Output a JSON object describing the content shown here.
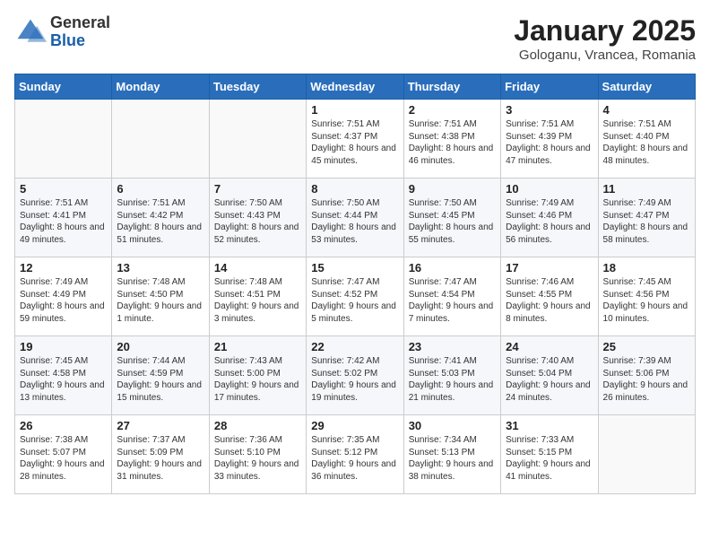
{
  "logo": {
    "general": "General",
    "blue": "Blue"
  },
  "title": "January 2025",
  "location": "Gologanu, Vrancea, Romania",
  "weekdays": [
    "Sunday",
    "Monday",
    "Tuesday",
    "Wednesday",
    "Thursday",
    "Friday",
    "Saturday"
  ],
  "weeks": [
    [
      {
        "day": "",
        "info": ""
      },
      {
        "day": "",
        "info": ""
      },
      {
        "day": "",
        "info": ""
      },
      {
        "day": "1",
        "info": "Sunrise: 7:51 AM\nSunset: 4:37 PM\nDaylight: 8 hours\nand 45 minutes."
      },
      {
        "day": "2",
        "info": "Sunrise: 7:51 AM\nSunset: 4:38 PM\nDaylight: 8 hours\nand 46 minutes."
      },
      {
        "day": "3",
        "info": "Sunrise: 7:51 AM\nSunset: 4:39 PM\nDaylight: 8 hours\nand 47 minutes."
      },
      {
        "day": "4",
        "info": "Sunrise: 7:51 AM\nSunset: 4:40 PM\nDaylight: 8 hours\nand 48 minutes."
      }
    ],
    [
      {
        "day": "5",
        "info": "Sunrise: 7:51 AM\nSunset: 4:41 PM\nDaylight: 8 hours\nand 49 minutes."
      },
      {
        "day": "6",
        "info": "Sunrise: 7:51 AM\nSunset: 4:42 PM\nDaylight: 8 hours\nand 51 minutes."
      },
      {
        "day": "7",
        "info": "Sunrise: 7:50 AM\nSunset: 4:43 PM\nDaylight: 8 hours\nand 52 minutes."
      },
      {
        "day": "8",
        "info": "Sunrise: 7:50 AM\nSunset: 4:44 PM\nDaylight: 8 hours\nand 53 minutes."
      },
      {
        "day": "9",
        "info": "Sunrise: 7:50 AM\nSunset: 4:45 PM\nDaylight: 8 hours\nand 55 minutes."
      },
      {
        "day": "10",
        "info": "Sunrise: 7:49 AM\nSunset: 4:46 PM\nDaylight: 8 hours\nand 56 minutes."
      },
      {
        "day": "11",
        "info": "Sunrise: 7:49 AM\nSunset: 4:47 PM\nDaylight: 8 hours\nand 58 minutes."
      }
    ],
    [
      {
        "day": "12",
        "info": "Sunrise: 7:49 AM\nSunset: 4:49 PM\nDaylight: 8 hours\nand 59 minutes."
      },
      {
        "day": "13",
        "info": "Sunrise: 7:48 AM\nSunset: 4:50 PM\nDaylight: 9 hours\nand 1 minute."
      },
      {
        "day": "14",
        "info": "Sunrise: 7:48 AM\nSunset: 4:51 PM\nDaylight: 9 hours\nand 3 minutes."
      },
      {
        "day": "15",
        "info": "Sunrise: 7:47 AM\nSunset: 4:52 PM\nDaylight: 9 hours\nand 5 minutes."
      },
      {
        "day": "16",
        "info": "Sunrise: 7:47 AM\nSunset: 4:54 PM\nDaylight: 9 hours\nand 7 minutes."
      },
      {
        "day": "17",
        "info": "Sunrise: 7:46 AM\nSunset: 4:55 PM\nDaylight: 9 hours\nand 8 minutes."
      },
      {
        "day": "18",
        "info": "Sunrise: 7:45 AM\nSunset: 4:56 PM\nDaylight: 9 hours\nand 10 minutes."
      }
    ],
    [
      {
        "day": "19",
        "info": "Sunrise: 7:45 AM\nSunset: 4:58 PM\nDaylight: 9 hours\nand 13 minutes."
      },
      {
        "day": "20",
        "info": "Sunrise: 7:44 AM\nSunset: 4:59 PM\nDaylight: 9 hours\nand 15 minutes."
      },
      {
        "day": "21",
        "info": "Sunrise: 7:43 AM\nSunset: 5:00 PM\nDaylight: 9 hours\nand 17 minutes."
      },
      {
        "day": "22",
        "info": "Sunrise: 7:42 AM\nSunset: 5:02 PM\nDaylight: 9 hours\nand 19 minutes."
      },
      {
        "day": "23",
        "info": "Sunrise: 7:41 AM\nSunset: 5:03 PM\nDaylight: 9 hours\nand 21 minutes."
      },
      {
        "day": "24",
        "info": "Sunrise: 7:40 AM\nSunset: 5:04 PM\nDaylight: 9 hours\nand 24 minutes."
      },
      {
        "day": "25",
        "info": "Sunrise: 7:39 AM\nSunset: 5:06 PM\nDaylight: 9 hours\nand 26 minutes."
      }
    ],
    [
      {
        "day": "26",
        "info": "Sunrise: 7:38 AM\nSunset: 5:07 PM\nDaylight: 9 hours\nand 28 minutes."
      },
      {
        "day": "27",
        "info": "Sunrise: 7:37 AM\nSunset: 5:09 PM\nDaylight: 9 hours\nand 31 minutes."
      },
      {
        "day": "28",
        "info": "Sunrise: 7:36 AM\nSunset: 5:10 PM\nDaylight: 9 hours\nand 33 minutes."
      },
      {
        "day": "29",
        "info": "Sunrise: 7:35 AM\nSunset: 5:12 PM\nDaylight: 9 hours\nand 36 minutes."
      },
      {
        "day": "30",
        "info": "Sunrise: 7:34 AM\nSunset: 5:13 PM\nDaylight: 9 hours\nand 38 minutes."
      },
      {
        "day": "31",
        "info": "Sunrise: 7:33 AM\nSunset: 5:15 PM\nDaylight: 9 hours\nand 41 minutes."
      },
      {
        "day": "",
        "info": ""
      }
    ]
  ]
}
